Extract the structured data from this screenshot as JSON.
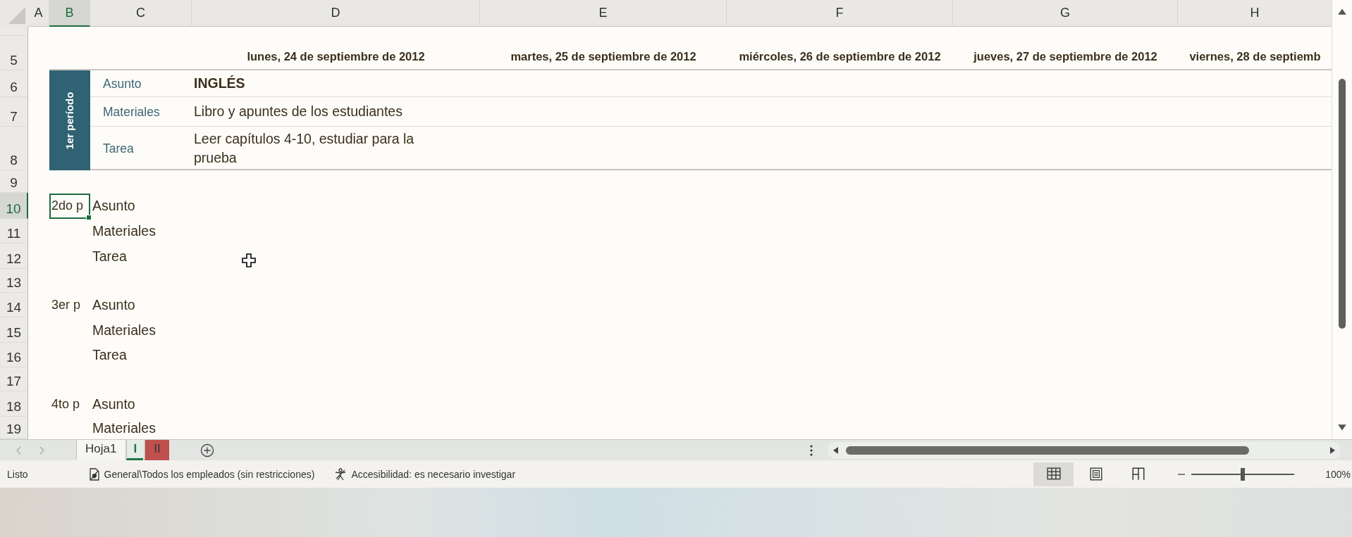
{
  "column_headers": [
    {
      "label": "A",
      "selected": false
    },
    {
      "label": "B",
      "selected": true
    },
    {
      "label": "C",
      "selected": false
    },
    {
      "label": "D",
      "selected": false
    },
    {
      "label": "E",
      "selected": false
    },
    {
      "label": "F",
      "selected": false
    },
    {
      "label": "G",
      "selected": false
    },
    {
      "label": "H",
      "selected": false
    }
  ],
  "row_headers": [
    {
      "label": "5",
      "selected": false
    },
    {
      "label": "6",
      "selected": false
    },
    {
      "label": "7",
      "selected": false
    },
    {
      "label": "8",
      "selected": false
    },
    {
      "label": "9",
      "selected": false
    },
    {
      "label": "10",
      "selected": true
    },
    {
      "label": "11",
      "selected": false
    },
    {
      "label": "12",
      "selected": false
    },
    {
      "label": "13",
      "selected": false
    },
    {
      "label": "14",
      "selected": false
    },
    {
      "label": "15",
      "selected": false
    },
    {
      "label": "16",
      "selected": false
    },
    {
      "label": "17",
      "selected": false
    },
    {
      "label": "18",
      "selected": false
    },
    {
      "label": "19",
      "selected": false
    }
  ],
  "date_headers": [
    "lunes, 24 de septiembre de 2012",
    "martes, 25 de septiembre de 2012",
    "miércoles, 26 de septiembre de 2012",
    "jueves, 27 de septiembre de 2012",
    "viernes, 28 de septiemb"
  ],
  "first_period": {
    "label": "1er período",
    "fields": [
      {
        "label": "Asunto",
        "value": "INGLÉS",
        "kind": "title"
      },
      {
        "label": "Materiales",
        "value": "Libro y apuntes de los estudiantes",
        "kind": "text"
      },
      {
        "label": "Tarea",
        "value": "Leer capítulos 4-10, estudiar para la prueba",
        "kind": "text"
      }
    ]
  },
  "other_periods": [
    {
      "label": "2do p",
      "selected": true,
      "fields": [
        "Asunto",
        "Materiales",
        "Tarea"
      ]
    },
    {
      "label": "3er p",
      "selected": false,
      "fields": [
        "Asunto",
        "Materiales",
        "Tarea"
      ]
    },
    {
      "label": "4to p",
      "selected": false,
      "fields": [
        "Asunto",
        "Materiales"
      ]
    }
  ],
  "sheet_tabs": [
    {
      "label": "Hoja1",
      "selected": false
    },
    {
      "label": "I",
      "selected": true,
      "color": "#217346"
    },
    {
      "label": "II",
      "selected": false,
      "color": "#c0504d"
    }
  ],
  "status_bar": {
    "ready": "Listo",
    "sensitivity": "General\\Todos los empleados (sin restricciones)",
    "accessibility": "Accesibilidad: es necesario investigar",
    "views": [
      {
        "kind": "normal",
        "selected": true
      },
      {
        "kind": "page_layout",
        "selected": false
      },
      {
        "kind": "page_break",
        "selected": false
      }
    ],
    "zoom": {
      "level": 0.5,
      "reading": "100%"
    }
  }
}
